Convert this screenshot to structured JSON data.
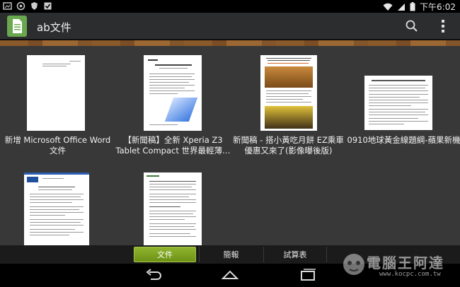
{
  "status_bar": {
    "time": "下午6:02"
  },
  "action_bar": {
    "title": "ab文件",
    "icons": [
      "document-app-icon",
      "search-icon",
      "overflow-menu-icon"
    ]
  },
  "documents": [
    {
      "label": "新增 Microsoft Office Word 文件"
    },
    {
      "label": "【新聞稿】全新 Xperia Z3 Tablet Compact 世界最輕薄…"
    },
    {
      "label": "新聞稿 - 搭小黃吃月餅 EZ乘車優惠又來了(影像曝後版)"
    },
    {
      "label": "0910地球黃金線題綱-蘋果新機"
    },
    {
      "label": ""
    },
    {
      "label": ""
    }
  ],
  "tabs": [
    {
      "label": "文件",
      "active": true
    },
    {
      "label": "簡報",
      "active": false
    },
    {
      "label": "試算表",
      "active": false
    }
  ],
  "watermark": {
    "text": "電腦王阿達",
    "url": "www.kocpc.com.tw"
  },
  "colors": {
    "accent": "#7aa321",
    "app_icon": "#6aa84f",
    "actionbar": "#2b2d2f",
    "content_bg": "#383838"
  }
}
